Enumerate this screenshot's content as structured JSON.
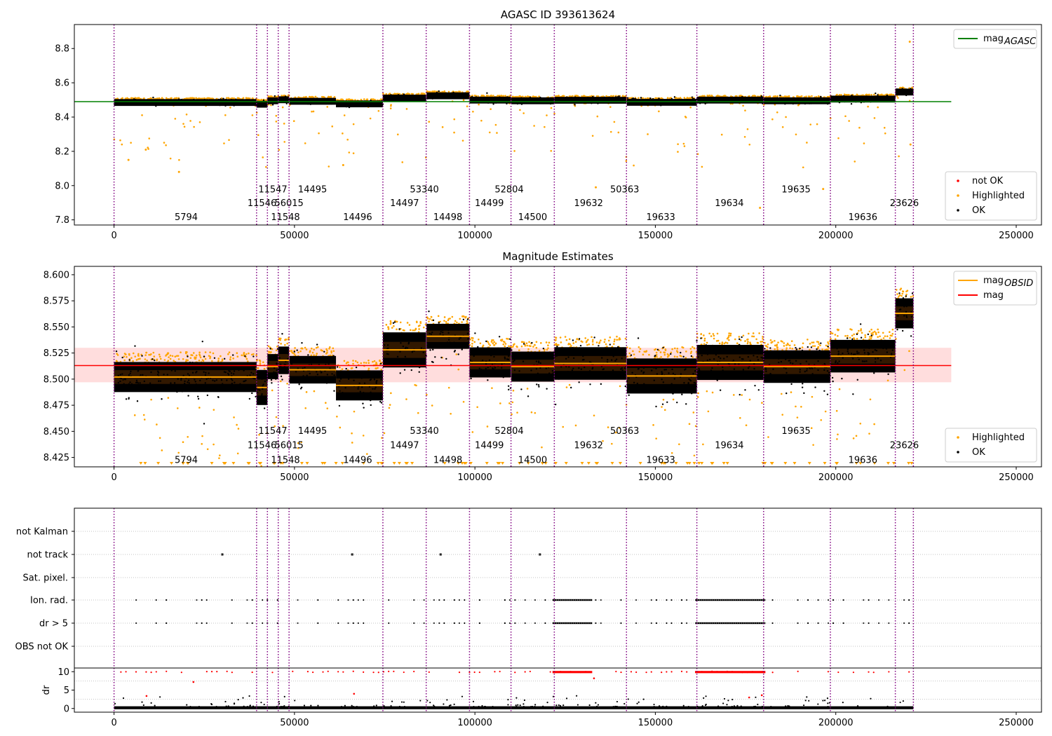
{
  "chart_data": [
    {
      "type": "scatter",
      "title": "AGASC ID 393613624",
      "xlim": [
        -11000,
        257000
      ],
      "ylim": [
        7.77,
        8.94
      ],
      "x_ticks": [
        0,
        50000,
        100000,
        150000,
        200000,
        250000
      ],
      "x_tick_labels": [
        "0",
        "50000",
        "100000",
        "150000",
        "200000",
        "250000"
      ],
      "y_ticks": [
        7.8,
        8.0,
        8.2,
        8.4,
        8.6,
        8.8
      ],
      "y_tick_labels": [
        "7.8",
        "8.0",
        "8.2",
        "8.4",
        "8.6",
        "8.8"
      ],
      "hlines": [
        {
          "name": "mag_AGASC",
          "y": 8.49,
          "color": "#008000",
          "x_range": [
            -11000,
            232000
          ]
        }
      ],
      "legends": [
        {
          "position": "top-right",
          "entries": [
            {
              "label": "mag",
              "sub": "AGASC",
              "color": "#008000",
              "kind": "line"
            }
          ]
        },
        {
          "position": "bottom-right",
          "entries": [
            {
              "label": "not OK",
              "color": "#ff0000",
              "kind": "dot"
            },
            {
              "label": "Highlighted",
              "color": "#ffa500",
              "kind": "dot"
            },
            {
              "label": "OK",
              "color": "#000000",
              "kind": "dot"
            }
          ]
        }
      ],
      "label_rows_y": [
        7.98,
        7.9,
        7.82
      ]
    },
    {
      "type": "scatter",
      "title": "Magnitude Estimates",
      "xlim": [
        -11000,
        257000
      ],
      "ylim": [
        8.416,
        8.608
      ],
      "x_ticks": [
        0,
        50000,
        100000,
        150000,
        200000,
        250000
      ],
      "x_tick_labels": [
        "0",
        "50000",
        "100000",
        "150000",
        "200000",
        "250000"
      ],
      "y_ticks": [
        8.425,
        8.45,
        8.475,
        8.5,
        8.525,
        8.55,
        8.575,
        8.6
      ],
      "y_tick_labels": [
        "8.425",
        "8.450",
        "8.475",
        "8.500",
        "8.525",
        "8.550",
        "8.575",
        "8.600"
      ],
      "hlines": [
        {
          "name": "mag",
          "y": 8.513,
          "color": "#ff0000",
          "x_range": [
            -11000,
            232000
          ]
        }
      ],
      "band": {
        "y_low": 8.497,
        "y_high": 8.53,
        "color": "#ffdddd"
      },
      "legends": [
        {
          "position": "top-right",
          "entries": [
            {
              "label": "mag",
              "sub": "OBSID",
              "color": "#ffa500",
              "kind": "line"
            },
            {
              "label": "mag",
              "sub": "",
              "color": "#ff0000",
              "kind": "line"
            }
          ]
        },
        {
          "position": "bottom-right",
          "entries": [
            {
              "label": "Highlighted",
              "color": "#ffa500",
              "kind": "dot"
            },
            {
              "label": "OK",
              "color": "#000000",
              "kind": "dot"
            }
          ]
        }
      ],
      "label_rows_y": [
        8.451,
        8.437,
        8.423
      ]
    },
    {
      "type": "scatter",
      "title": "",
      "category_axis": {
        "labels": [
          "not Kalman",
          "not track",
          "Sat. pixel.",
          "Ion. rad.",
          "dr > 5",
          "OBS not OK"
        ],
        "flag_points": {
          "not track": [
            30000,
            66000,
            90500,
            118000
          ],
          "not Kalman": [],
          "Sat. pixel.": [],
          "OBS not OK": []
        },
        "dense_ranges_ion_dr5": [
          [
            121500,
            132500
          ],
          [
            161000,
            180500
          ]
        ]
      },
      "dr_axis": {
        "label": "dr",
        "ylim": [
          -1,
          11
        ],
        "y_ticks": [
          0,
          5,
          10
        ],
        "y_tick_labels": [
          "0",
          "5",
          "10"
        ]
      },
      "x_ticks": [
        0,
        50000,
        100000,
        150000,
        200000,
        250000
      ],
      "x_tick_labels": [
        "0",
        "50000",
        "100000",
        "150000",
        "200000",
        "250000"
      ]
    }
  ],
  "observations": [
    {
      "obsid": "5794",
      "start": 0,
      "end": 39500,
      "mag": 8.502,
      "std": 0.012,
      "row": 2
    },
    {
      "obsid": "11546",
      "start": 39500,
      "end": 42500,
      "mag": 8.492,
      "std": 0.014,
      "row": 1
    },
    {
      "obsid": "11547",
      "start": 42500,
      "end": 45500,
      "mag": 8.512,
      "std": 0.01,
      "row": 0
    },
    {
      "obsid": "11548",
      "start": 45500,
      "end": 48500,
      "mag": 8.518,
      "std": 0.011,
      "row": 2
    },
    {
      "obsid": "56015",
      "start": 48500,
      "end": 48600,
      "mag": 8.518,
      "std": 0.011,
      "row": 1
    },
    {
      "obsid": "14495",
      "start": 48600,
      "end": 61500,
      "mag": 8.509,
      "std": 0.011,
      "row": 0
    },
    {
      "obsid": "14496",
      "start": 61500,
      "end": 74500,
      "mag": 8.494,
      "std": 0.012,
      "row": 2
    },
    {
      "obsid": "14497",
      "start": 74500,
      "end": 86500,
      "mag": 8.528,
      "std": 0.014,
      "row": 1
    },
    {
      "obsid": "53340",
      "start": 86500,
      "end": 86600,
      "mag": 8.528,
      "std": 0.014,
      "row": 0
    },
    {
      "obsid": "14498",
      "start": 86600,
      "end": 98500,
      "mag": 8.541,
      "std": 0.01,
      "row": 2
    },
    {
      "obsid": "14499",
      "start": 98500,
      "end": 110000,
      "mag": 8.516,
      "std": 0.012,
      "row": 1
    },
    {
      "obsid": "52804",
      "start": 110000,
      "end": 110100,
      "mag": 8.516,
      "std": 0.012,
      "row": 0
    },
    {
      "obsid": "14500",
      "start": 110100,
      "end": 122000,
      "mag": 8.512,
      "std": 0.012,
      "row": 2
    },
    {
      "obsid": "19632",
      "start": 122000,
      "end": 142000,
      "mag": 8.515,
      "std": 0.013,
      "row": 1
    },
    {
      "obsid": "50363",
      "start": 142000,
      "end": 142100,
      "mag": 8.515,
      "std": 0.013,
      "row": 0
    },
    {
      "obsid": "19633",
      "start": 142100,
      "end": 161500,
      "mag": 8.503,
      "std": 0.014,
      "row": 2
    },
    {
      "obsid": "19634",
      "start": 161500,
      "end": 180000,
      "mag": 8.516,
      "std": 0.014,
      "row": 1
    },
    {
      "obsid": "19635",
      "start": 180000,
      "end": 198500,
      "mag": 8.512,
      "std": 0.013,
      "row": 0
    },
    {
      "obsid": "19636",
      "start": 198500,
      "end": 216500,
      "mag": 8.522,
      "std": 0.013,
      "row": 2
    },
    {
      "obsid": "23626",
      "start": 216500,
      "end": 221500,
      "mag": 8.563,
      "std": 0.012,
      "row": 1
    }
  ],
  "obsid_labels": [
    {
      "text": "5794",
      "x": 20000,
      "row": 2
    },
    {
      "text": "11546",
      "x": 41000,
      "row": 1
    },
    {
      "text": "11547",
      "x": 44000,
      "row": 0
    },
    {
      "text": "11548",
      "x": 47500,
      "row": 2
    },
    {
      "text": "56015",
      "x": 48500,
      "row": 1
    },
    {
      "text": "14495",
      "x": 55000,
      "row": 0
    },
    {
      "text": "14496",
      "x": 67500,
      "row": 2
    },
    {
      "text": "14497",
      "x": 80500,
      "row": 1
    },
    {
      "text": "53340",
      "x": 86000,
      "row": 0
    },
    {
      "text": "14498",
      "x": 92500,
      "row": 2
    },
    {
      "text": "14499",
      "x": 104000,
      "row": 1
    },
    {
      "text": "52804",
      "x": 109500,
      "row": 0
    },
    {
      "text": "14500",
      "x": 116000,
      "row": 2
    },
    {
      "text": "19632",
      "x": 131500,
      "row": 1
    },
    {
      "text": "50363",
      "x": 141500,
      "row": 0
    },
    {
      "text": "19633",
      "x": 151500,
      "row": 2
    },
    {
      "text": "19634",
      "x": 170500,
      "row": 1
    },
    {
      "text": "19635",
      "x": 189000,
      "row": 0
    },
    {
      "text": "19636",
      "x": 207500,
      "row": 2
    },
    {
      "text": "23626",
      "x": 219000,
      "row": 1
    }
  ],
  "vline_x": [
    0,
    39500,
    42500,
    45500,
    48500,
    74500,
    86500,
    98500,
    110000,
    122000,
    142000,
    161500,
    180000,
    198500,
    216500,
    221500
  ],
  "colors": {
    "ok": "#000000",
    "highlighted": "#ffa500",
    "not_ok": "#ff0000",
    "agasc_line": "#008000",
    "obsid_line": "#ffa500",
    "mag_line": "#ff0000",
    "vline": "#800080"
  }
}
